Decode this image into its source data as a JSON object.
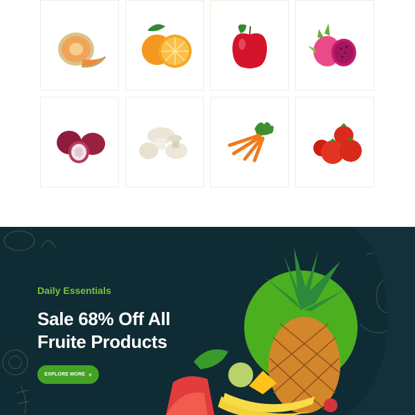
{
  "products": [
    {
      "name": "cantaloupe",
      "icon": "melon-icon"
    },
    {
      "name": "orange",
      "icon": "orange-icon"
    },
    {
      "name": "apple",
      "icon": "apple-icon"
    },
    {
      "name": "dragon-fruit",
      "icon": "dragonfruit-icon"
    },
    {
      "name": "onion",
      "icon": "onion-icon"
    },
    {
      "name": "mushroom",
      "icon": "mushroom-icon"
    },
    {
      "name": "carrot",
      "icon": "carrot-icon"
    },
    {
      "name": "tomato",
      "icon": "tomato-icon"
    }
  ],
  "banner": {
    "eyebrow": "Daily Essentials",
    "headline_line1": "Sale 68% Off All",
    "headline_line2": "Fruite Products",
    "cta_label": "EXPLORE MORE",
    "cta_icon": "double-chevron-right-icon",
    "colors": {
      "background": "#0f2b33",
      "accent": "#7bc142",
      "button": "#44a325",
      "circle": "#4caf1f"
    }
  }
}
